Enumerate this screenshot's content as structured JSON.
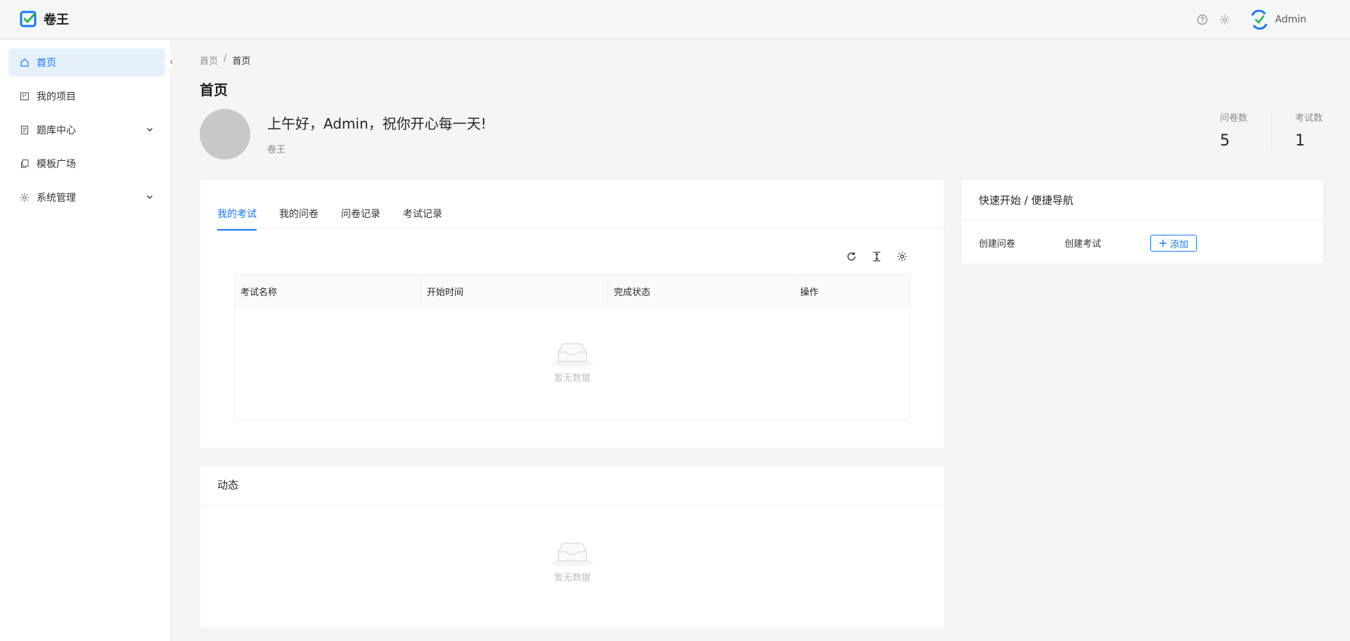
{
  "app": {
    "title": "卷王"
  },
  "header": {
    "user_name": "Admin"
  },
  "sidebar": {
    "items": [
      {
        "label": "首页"
      },
      {
        "label": "我的项目"
      },
      {
        "label": "题库中心"
      },
      {
        "label": "模板广场"
      },
      {
        "label": "系统管理"
      }
    ]
  },
  "breadcrumb": {
    "root": "首页",
    "separator": "/",
    "current": "首页"
  },
  "page": {
    "title": "首页"
  },
  "profile": {
    "greeting": "上午好，Admin，祝你开心每一天!",
    "subtitle": "卷王",
    "stats": [
      {
        "label": "问卷数",
        "value": "5"
      },
      {
        "label": "考试数",
        "value": "1"
      }
    ]
  },
  "exam_card": {
    "tabs": [
      {
        "label": "我的考试"
      },
      {
        "label": "我的问卷"
      },
      {
        "label": "问卷记录"
      },
      {
        "label": "考试记录"
      }
    ],
    "columns": [
      "考试名称",
      "开始时间",
      "完成状态",
      "操作"
    ],
    "empty_text": "暂无数据"
  },
  "activity_card": {
    "title": "动态",
    "empty_text": "暂无数据"
  },
  "quick_card": {
    "title": "快速开始 / 便捷导航",
    "links": [
      {
        "label": "创建问卷"
      },
      {
        "label": "创建考试"
      }
    ],
    "add_label": "添加"
  },
  "colors": {
    "accent": "#1677ff",
    "active_bg": "#e6f0fd"
  }
}
